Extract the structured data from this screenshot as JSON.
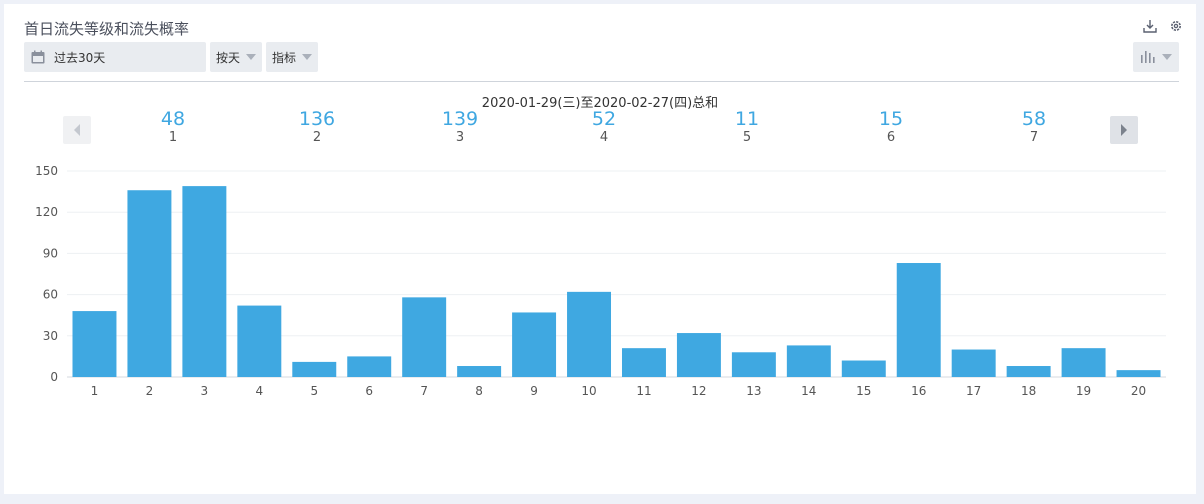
{
  "header": {
    "title": "首日流失等级和流失概率"
  },
  "toolbar": {
    "date_range": "过去30天",
    "granularity": "按天",
    "metric": "指标"
  },
  "icons": {
    "download": "download-icon",
    "settings": "gear-icon",
    "calendar": "calendar-icon",
    "chart_type": "bar-chart-icon"
  },
  "colors": {
    "bar": "#3fa8e1",
    "summary_value": "#3fa7e1",
    "grid": "#edf0f3"
  },
  "summary": {
    "range_label": "2020-01-29(三)至2020-02-27(四)总和",
    "items": [
      {
        "value": "48",
        "label": "1"
      },
      {
        "value": "136",
        "label": "2"
      },
      {
        "value": "139",
        "label": "3"
      },
      {
        "value": "52",
        "label": "4"
      },
      {
        "value": "11",
        "label": "5"
      },
      {
        "value": "15",
        "label": "6"
      },
      {
        "value": "58",
        "label": "7"
      }
    ]
  },
  "chart_data": {
    "type": "bar",
    "categories": [
      "1",
      "2",
      "3",
      "4",
      "5",
      "6",
      "7",
      "8",
      "9",
      "10",
      "11",
      "12",
      "13",
      "14",
      "15",
      "16",
      "17",
      "18",
      "19",
      "20"
    ],
    "values": [
      48,
      136,
      139,
      52,
      11,
      15,
      58,
      8,
      47,
      62,
      21,
      32,
      18,
      23,
      12,
      83,
      20,
      8,
      21,
      5
    ],
    "yticks": [
      0,
      30,
      60,
      90,
      120,
      150
    ],
    "ylim": [
      0,
      150
    ],
    "grid": true,
    "title": "",
    "xlabel": "",
    "ylabel": ""
  }
}
